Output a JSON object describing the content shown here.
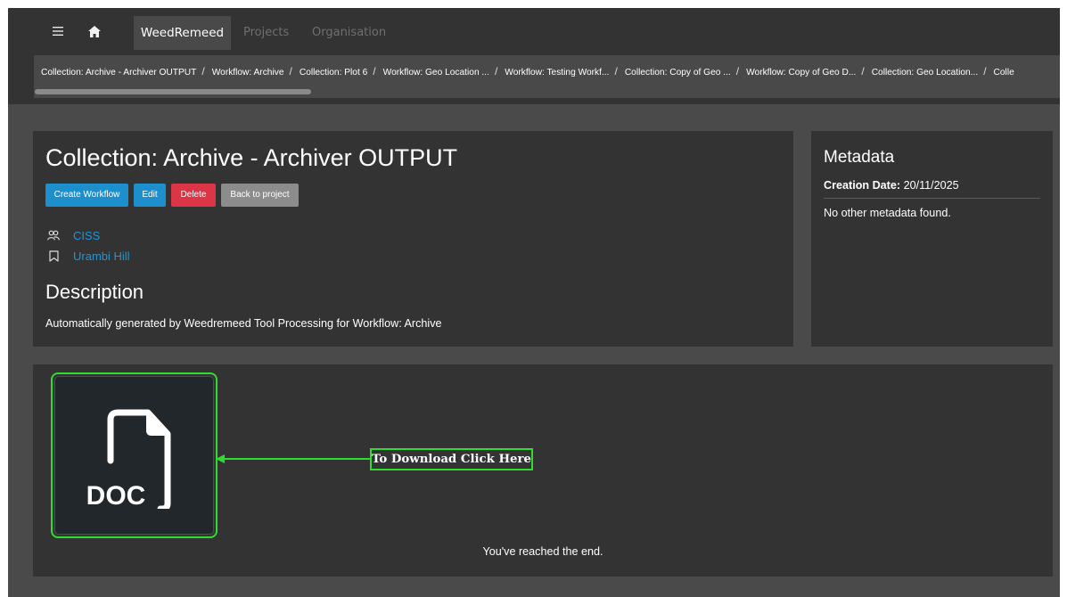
{
  "navbar": {
    "brand": "WeedRemeed",
    "tabs": [
      "Projects",
      "Organisation"
    ],
    "menu_icon": "hamburger-menu-icon",
    "home_icon": "home-icon"
  },
  "breadcrumb": [
    "Collection: Archive - Archiver OUTPUT",
    "Workflow: Archive",
    "Collection: Plot 6",
    "Workflow: Geo Location ...",
    "Workflow: Testing Workf...",
    "Collection: Copy of Geo ...",
    "Workflow: Copy of Geo D...",
    "Collection: Geo Location...",
    "Colle"
  ],
  "collection": {
    "title": "Collection: Archive - Archiver OUTPUT",
    "buttons": {
      "create_workflow": "Create Workflow",
      "edit": "Edit",
      "delete": "Delete",
      "back_to_project": "Back to project"
    },
    "organisation": "CISS",
    "tag": "Urambi Hill",
    "description_heading": "Description",
    "description": "Automatically generated by Weedremeed Tool Processing for Workflow: Archive"
  },
  "metadata": {
    "heading": "Metadata",
    "creation_date_label": "Creation Date:",
    "creation_date": "20/11/2025",
    "none_text": "No other metadata found."
  },
  "files": {
    "file_label": "DOC",
    "download_hint": "To Download Click Here",
    "end_text": "You've reached the end."
  },
  "colors": {
    "primary": "#1c8fcc",
    "danger": "#dc3545",
    "secondary": "#8c8c8c",
    "link": "#1f96d6",
    "highlight": "#2fdc2f"
  }
}
